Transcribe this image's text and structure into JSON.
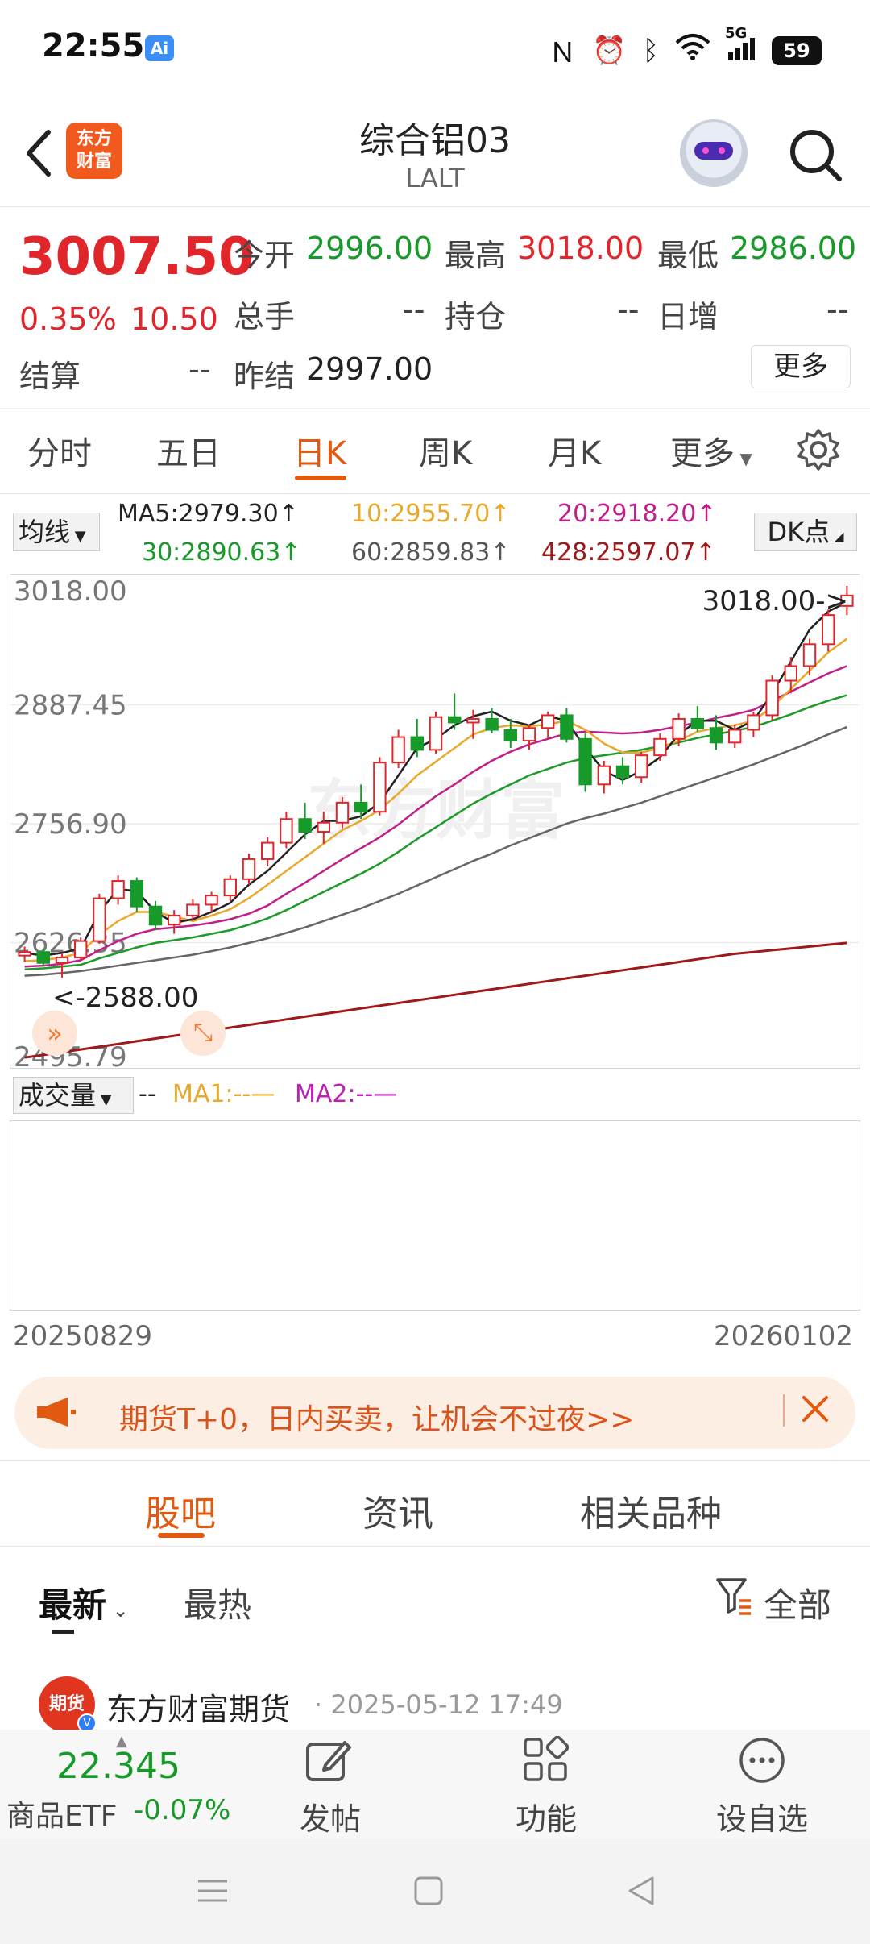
{
  "status_bar": {
    "time": "22:55",
    "ai_badge": "Ai",
    "network": "5G",
    "battery": "59"
  },
  "header": {
    "logo_text": "东方\n财富",
    "title": "综合铝03",
    "subtitle": "LALT"
  },
  "quote": {
    "last_price": "3007.50",
    "change_pct": "0.35%",
    "change": "10.50",
    "open_label": "今开",
    "open": "2996.00",
    "high_label": "最高",
    "high": "3018.00",
    "low_label": "最低",
    "low": "2986.00",
    "volume_label": "总手",
    "volume": "--",
    "oi_label": "持仓",
    "oi": "--",
    "oi_change_label": "日增",
    "oi_change": "--",
    "settle_label": "结算",
    "settle": "--",
    "prev_settle_label": "昨结",
    "prev_settle": "2997.00",
    "more_label": "更多"
  },
  "period_tabs": [
    "分时",
    "五日",
    "日K",
    "周K",
    "月K",
    "更多"
  ],
  "active_period": "日K",
  "ma_bar": {
    "select_label": "均线",
    "ma5": "MA5:2979.30↑",
    "ma10": "10:2955.70↑",
    "ma20": "20:2918.20↑",
    "ma30": "30:2890.63↑",
    "ma60": "60:2859.83↑",
    "ma428": "428:2597.07↑",
    "dk_label": "DK点"
  },
  "chart_data": {
    "type": "candlestick",
    "y_ticks": [
      "3018.00",
      "2887.45",
      "2756.90",
      "2626.35",
      "2495.79"
    ],
    "ylim": [
      2495.79,
      3018.0
    ],
    "max_label": "3018.00->",
    "min_label": "<-2588.00",
    "x_start": "20250829",
    "x_end": "20260102",
    "watermark": "东方财富",
    "colors": {
      "up": "#e0262b",
      "down": "#179a2a",
      "ma5": "#222222",
      "ma10": "#e9a82b",
      "ma20": "#c01f8a",
      "ma30": "#1e9a2a",
      "ma60": "#666666",
      "ma428": "#a01818"
    },
    "ma5": [
      2615,
      2612,
      2615,
      2620,
      2660,
      2685,
      2683,
      2660,
      2648,
      2652,
      2660,
      2670,
      2690,
      2705,
      2725,
      2745,
      2760,
      2760,
      2765,
      2780,
      2810,
      2840,
      2850,
      2865,
      2875,
      2880,
      2870,
      2865,
      2875,
      2870,
      2840,
      2815,
      2805,
      2815,
      2830,
      2855,
      2870,
      2870,
      2860,
      2870,
      2900,
      2935,
      2970,
      2990,
      3000
    ],
    "ma10": [
      2606,
      2607,
      2610,
      2615,
      2635,
      2650,
      2660,
      2660,
      2655,
      2650,
      2656,
      2663,
      2675,
      2690,
      2705,
      2720,
      2735,
      2750,
      2760,
      2772,
      2790,
      2810,
      2825,
      2840,
      2855,
      2862,
      2865,
      2864,
      2866,
      2870,
      2860,
      2845,
      2835,
      2835,
      2840,
      2848,
      2858,
      2862,
      2865,
      2870,
      2885,
      2905,
      2925,
      2945,
      2960
    ],
    "ma20": [
      2600,
      2601,
      2603,
      2607,
      2618,
      2628,
      2636,
      2641,
      2643,
      2645,
      2648,
      2652,
      2658,
      2667,
      2680,
      2692,
      2705,
      2718,
      2730,
      2742,
      2756,
      2772,
      2787,
      2800,
      2814,
      2826,
      2836,
      2844,
      2850,
      2856,
      2858,
      2857,
      2856,
      2857,
      2860,
      2864,
      2868,
      2873,
      2877,
      2882,
      2892,
      2902,
      2912,
      2922,
      2930
    ],
    "ma30": [
      2597,
      2598,
      2600,
      2602,
      2609,
      2615,
      2621,
      2626,
      2629,
      2632,
      2636,
      2640,
      2646,
      2653,
      2662,
      2672,
      2682,
      2692,
      2702,
      2713,
      2726,
      2740,
      2753,
      2766,
      2779,
      2790,
      2800,
      2810,
      2817,
      2824,
      2829,
      2832,
      2835,
      2838,
      2842,
      2846,
      2851,
      2855,
      2859,
      2863,
      2870,
      2877,
      2885,
      2892,
      2898
    ],
    "ma60": [
      2590,
      2591,
      2593,
      2595,
      2598,
      2601,
      2604,
      2607,
      2610,
      2613,
      2617,
      2621,
      2626,
      2631,
      2637,
      2643,
      2650,
      2657,
      2664,
      2672,
      2680,
      2689,
      2698,
      2707,
      2716,
      2724,
      2733,
      2741,
      2749,
      2757,
      2763,
      2768,
      2774,
      2780,
      2787,
      2794,
      2801,
      2808,
      2815,
      2822,
      2830,
      2838,
      2846,
      2855,
      2863
    ],
    "ma428": [
      2500,
      2503,
      2506,
      2509,
      2512,
      2515,
      2518,
      2521,
      2524,
      2527,
      2530,
      2533,
      2536,
      2539,
      2542,
      2545,
      2548,
      2551,
      2554,
      2557,
      2560,
      2563,
      2566,
      2569,
      2572,
      2575,
      2578,
      2581,
      2584,
      2587,
      2590,
      2593,
      2596,
      2599,
      2602,
      2605,
      2608,
      2611,
      2614,
      2616,
      2618,
      2620,
      2622,
      2624,
      2626
    ],
    "candles": [
      [
        2612,
        2622,
        2605,
        2616
      ],
      [
        2616,
        2620,
        2600,
        2604
      ],
      [
        2604,
        2615,
        2588,
        2610
      ],
      [
        2610,
        2632,
        2606,
        2628
      ],
      [
        2628,
        2680,
        2625,
        2675
      ],
      [
        2675,
        2700,
        2668,
        2694
      ],
      [
        2694,
        2698,
        2660,
        2666
      ],
      [
        2666,
        2672,
        2640,
        2646
      ],
      [
        2646,
        2662,
        2636,
        2656
      ],
      [
        2656,
        2674,
        2650,
        2668
      ],
      [
        2668,
        2682,
        2660,
        2678
      ],
      [
        2678,
        2700,
        2672,
        2696
      ],
      [
        2696,
        2724,
        2690,
        2718
      ],
      [
        2718,
        2742,
        2710,
        2736
      ],
      [
        2736,
        2770,
        2730,
        2762
      ],
      [
        2762,
        2780,
        2740,
        2748
      ],
      [
        2748,
        2770,
        2735,
        2758
      ],
      [
        2758,
        2786,
        2752,
        2780
      ],
      [
        2780,
        2800,
        2762,
        2770
      ],
      [
        2770,
        2830,
        2766,
        2824
      ],
      [
        2824,
        2860,
        2818,
        2852
      ],
      [
        2852,
        2872,
        2830,
        2838
      ],
      [
        2838,
        2880,
        2834,
        2874
      ],
      [
        2874,
        2900,
        2860,
        2868
      ],
      [
        2868,
        2882,
        2850,
        2872
      ],
      [
        2872,
        2884,
        2856,
        2860
      ],
      [
        2860,
        2872,
        2840,
        2848
      ],
      [
        2848,
        2866,
        2838,
        2862
      ],
      [
        2862,
        2880,
        2850,
        2876
      ],
      [
        2876,
        2884,
        2846,
        2850
      ],
      [
        2850,
        2856,
        2792,
        2800
      ],
      [
        2800,
        2826,
        2790,
        2820
      ],
      [
        2820,
        2830,
        2800,
        2808
      ],
      [
        2808,
        2836,
        2802,
        2832
      ],
      [
        2832,
        2856,
        2826,
        2850
      ],
      [
        2850,
        2878,
        2842,
        2872
      ],
      [
        2872,
        2886,
        2858,
        2862
      ],
      [
        2862,
        2876,
        2838,
        2846
      ],
      [
        2846,
        2866,
        2840,
        2860
      ],
      [
        2860,
        2880,
        2852,
        2876
      ],
      [
        2876,
        2920,
        2870,
        2914
      ],
      [
        2914,
        2940,
        2900,
        2930
      ],
      [
        2930,
        2960,
        2920,
        2954
      ],
      [
        2954,
        2992,
        2946,
        2986
      ],
      [
        2996,
        3018,
        2986,
        3007.5
      ]
    ],
    "volume_label": "成交量",
    "vol_ma1": "MA1:--",
    "vol_ma2": "MA2:--"
  },
  "promo": {
    "text": "期货T+0，日内买卖，让机会不过夜>>"
  },
  "community_tabs": [
    "股吧",
    "资讯",
    "相关品种"
  ],
  "feed_tabs": {
    "latest": "最新",
    "hot": "最热",
    "filter": "全部"
  },
  "post": {
    "author": "东方财富期货",
    "avatar_text": "期货",
    "time": "· 2025-05-12 17:49"
  },
  "bottom_nav": {
    "ticker_price": "22.345",
    "ticker_name": "商品ETF",
    "ticker_change": "-0.07%",
    "post": "发帖",
    "functions": "功能",
    "watchlist": "设自选"
  }
}
